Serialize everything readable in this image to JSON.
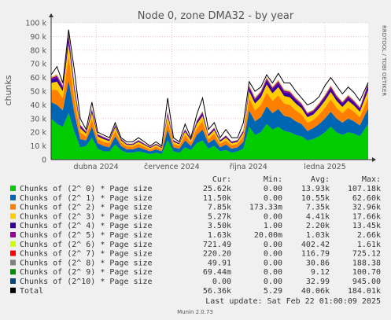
{
  "chart_data": {
    "type": "area",
    "title": "Node 0, zone DMA32 - by year",
    "ylabel": "chunks",
    "side_label": "RRDTOOL / TOBI OETIKER",
    "ylim": [
      0,
      100000
    ],
    "y_ticks": [
      {
        "value": 0,
        "label": "0"
      },
      {
        "value": 10000,
        "label": "10 k"
      },
      {
        "value": 20000,
        "label": "20 k"
      },
      {
        "value": 30000,
        "label": "30 k"
      },
      {
        "value": 40000,
        "label": "40 k"
      },
      {
        "value": 50000,
        "label": "50 k"
      },
      {
        "value": 60000,
        "label": "60 k"
      },
      {
        "value": 70000,
        "label": "70 k"
      },
      {
        "value": 80000,
        "label": "80 k"
      },
      {
        "value": 90000,
        "label": "90 k"
      },
      {
        "value": 100000,
        "label": "100 k"
      }
    ],
    "x_domain": [
      "2024-02-07",
      "2025-02-22"
    ],
    "x_ticks": [
      {
        "date": "2024-04-01",
        "label": "dubna 2024"
      },
      {
        "date": "2024-07-01",
        "label": "července 2024"
      },
      {
        "date": "2024-10-01",
        "label": "října 2024"
      },
      {
        "date": "2025-01-01",
        "label": "ledna 2025"
      }
    ],
    "sample_dates": [
      "2024-02-07",
      "2024-02-14",
      "2024-02-21",
      "2024-02-28",
      "2024-03-06",
      "2024-03-13",
      "2024-03-20",
      "2024-03-27",
      "2024-04-03",
      "2024-04-10",
      "2024-04-17",
      "2024-04-24",
      "2024-05-01",
      "2024-05-08",
      "2024-05-15",
      "2024-05-22",
      "2024-05-29",
      "2024-06-05",
      "2024-06-12",
      "2024-06-19",
      "2024-06-26",
      "2024-07-03",
      "2024-07-10",
      "2024-07-17",
      "2024-07-24",
      "2024-07-31",
      "2024-08-07",
      "2024-08-14",
      "2024-08-21",
      "2024-08-28",
      "2024-09-04",
      "2024-09-11",
      "2024-09-18",
      "2024-09-25",
      "2024-10-02",
      "2024-10-09",
      "2024-10-16",
      "2024-10-23",
      "2024-10-30",
      "2024-11-06",
      "2024-11-13",
      "2024-11-20",
      "2024-11-27",
      "2024-12-04",
      "2024-12-11",
      "2024-12-18",
      "2024-12-25",
      "2025-01-01",
      "2025-01-08",
      "2025-01-15",
      "2025-01-22",
      "2025-01-29",
      "2025-02-05",
      "2025-02-12",
      "2025-02-22"
    ],
    "columns": [
      "Cur:",
      "Min:",
      "Avg:",
      "Max:"
    ],
    "series": [
      {
        "name": "Chunks of (2^ 0) * Page size",
        "color": "#00cc00",
        "cur": "25.62k",
        "min": "0.00",
        "avg": "13.93k",
        "max": "107.18k",
        "values": [
          30000,
          26000,
          24000,
          34000,
          20000,
          9000,
          10000,
          16000,
          8000,
          6000,
          6000,
          11000,
          7000,
          5000,
          5000,
          6000,
          5000,
          4000,
          5000,
          4000,
          14000,
          6000,
          5000,
          9000,
          7000,
          12000,
          14000,
          8000,
          10000,
          6000,
          7000,
          5000,
          6000,
          8000,
          24000,
          18000,
          20000,
          26000,
          22000,
          24000,
          21000,
          20000,
          18000,
          17000,
          14000,
          15000,
          17000,
          20000,
          24000,
          20000,
          18000,
          20000,
          19000,
          17000,
          26000
        ]
      },
      {
        "name": "Chunks of (2^ 1) * Page size",
        "color": "#0066b3",
        "cur": "11.50k",
        "min": "0.00",
        "avg": "10.55k",
        "max": "62.60k",
        "values": [
          12000,
          14000,
          12000,
          24000,
          14000,
          6000,
          4000,
          8000,
          4000,
          4000,
          3000,
          6000,
          3000,
          2500,
          2500,
          3000,
          2500,
          2000,
          2500,
          2000,
          8000,
          3000,
          3000,
          5000,
          3000,
          6000,
          8000,
          4000,
          5000,
          3000,
          4000,
          3000,
          3000,
          5000,
          12000,
          10000,
          11000,
          13000,
          12000,
          13000,
          11000,
          11000,
          10000,
          9000,
          7000,
          8000,
          9000,
          10000,
          11000,
          10000,
          9000,
          10000,
          9000,
          8000,
          11500
        ]
      },
      {
        "name": "Chunks of (2^ 2) * Page size",
        "color": "#ff8000",
        "cur": "7.85k",
        "min": "173.33m",
        "avg": "7.35k",
        "max": "32.96k",
        "values": [
          9000,
          11000,
          9000,
          18000,
          10000,
          5000,
          3000,
          6000,
          3000,
          3000,
          3000,
          4000,
          2500,
          2000,
          2000,
          2500,
          2000,
          1500,
          2000,
          1500,
          6000,
          2500,
          2000,
          4000,
          2500,
          5000,
          6000,
          3000,
          4000,
          2500,
          3000,
          2500,
          2500,
          4000,
          9000,
          8000,
          9000,
          10000,
          9000,
          10000,
          9000,
          9000,
          8000,
          7000,
          6000,
          6000,
          7000,
          8000,
          9000,
          8000,
          7000,
          8000,
          7000,
          6000,
          7850
        ]
      },
      {
        "name": "Chunks of (2^ 3) * Page size",
        "color": "#ffcc00",
        "cur": "5.27k",
        "min": "0.00",
        "avg": "4.41k",
        "max": "17.66k",
        "values": [
          5000,
          6000,
          5000,
          9000,
          6000,
          3000,
          2000,
          4000,
          2000,
          2000,
          1500,
          2500,
          1500,
          1200,
          1200,
          1500,
          1200,
          1000,
          1200,
          1000,
          4000,
          1500,
          1200,
          2500,
          1500,
          3000,
          4000,
          2000,
          2500,
          1500,
          2000,
          1500,
          1500,
          2500,
          5000,
          5000,
          5500,
          6000,
          5500,
          6000,
          5500,
          5500,
          5000,
          4500,
          4000,
          4000,
          4500,
          5000,
          5500,
          5000,
          4500,
          5000,
          4500,
          4000,
          5270
        ]
      },
      {
        "name": "Chunks of (2^ 4) * Page size",
        "color": "#330099",
        "cur": "3.50k",
        "min": "1.00",
        "avg": "2.20k",
        "max": "13.45k",
        "values": [
          2500,
          3000,
          2500,
          5000,
          3000,
          1500,
          1000,
          2000,
          1000,
          1000,
          800,
          1200,
          800,
          600,
          600,
          800,
          600,
          500,
          600,
          500,
          2000,
          800,
          600,
          1200,
          800,
          1500,
          2000,
          1000,
          1200,
          800,
          1000,
          800,
          800,
          1200,
          2500,
          2500,
          2800,
          3000,
          2800,
          3000,
          2800,
          2800,
          2500,
          2200,
          2000,
          2000,
          2200,
          2500,
          2800,
          2500,
          2200,
          2500,
          2200,
          2000,
          3500
        ]
      },
      {
        "name": "Chunks of (2^ 5) * Page size",
        "color": "#990099",
        "cur": "1.63k",
        "min": "20.00m",
        "avg": "1.03k",
        "max": "2.66k",
        "values": [
          1200,
          1400,
          1200,
          2000,
          1400,
          800,
          500,
          1000,
          500,
          500,
          400,
          600,
          400,
          300,
          300,
          400,
          300,
          250,
          300,
          250,
          1000,
          400,
          300,
          600,
          400,
          800,
          1000,
          500,
          600,
          400,
          500,
          400,
          400,
          600,
          1200,
          1200,
          1300,
          1400,
          1300,
          1400,
          1300,
          1300,
          1200,
          1100,
          1000,
          1000,
          1100,
          1200,
          1300,
          1200,
          1100,
          1200,
          1100,
          1000,
          1630
        ]
      },
      {
        "name": "Chunks of (2^ 6) * Page size",
        "color": "#ccff00",
        "cur": "721.49",
        "min": "0.00",
        "avg": "402.42",
        "max": "1.61k",
        "values": [
          500,
          600,
          500,
          900,
          600,
          300,
          200,
          400,
          200,
          200,
          150,
          250,
          150,
          120,
          120,
          150,
          120,
          100,
          120,
          100,
          400,
          150,
          120,
          250,
          150,
          300,
          400,
          200,
          250,
          150,
          200,
          150,
          150,
          250,
          500,
          500,
          550,
          600,
          550,
          600,
          550,
          550,
          500,
          450,
          400,
          400,
          450,
          500,
          550,
          500,
          450,
          500,
          450,
          400,
          721
        ]
      },
      {
        "name": "Chunks of (2^ 7) * Page size",
        "color": "#ff0000",
        "cur": "220.20",
        "min": "0.00",
        "avg": "116.79",
        "max": "725.12",
        "values": [
          150,
          180,
          150,
          300,
          180,
          90,
          60,
          120,
          60,
          60,
          45,
          75,
          45,
          36,
          36,
          45,
          36,
          30,
          36,
          30,
          120,
          45,
          36,
          75,
          45,
          90,
          120,
          60,
          75,
          45,
          60,
          45,
          45,
          75,
          150,
          150,
          165,
          180,
          165,
          180,
          165,
          165,
          150,
          135,
          120,
          120,
          135,
          150,
          165,
          150,
          135,
          150,
          135,
          120,
          220
        ]
      },
      {
        "name": "Chunks of (2^ 8) * Page size",
        "color": "#808080",
        "cur": "49.91",
        "min": "0.00",
        "avg": "30.86",
        "max": "188.38",
        "values": [
          40,
          45,
          40,
          80,
          45,
          24,
          16,
          30,
          16,
          16,
          12,
          20,
          12,
          10,
          10,
          12,
          10,
          8,
          10,
          8,
          30,
          12,
          10,
          20,
          12,
          24,
          30,
          16,
          20,
          12,
          16,
          12,
          12,
          20,
          40,
          40,
          44,
          48,
          44,
          48,
          44,
          44,
          40,
          36,
          32,
          32,
          36,
          40,
          44,
          40,
          36,
          40,
          36,
          32,
          50
        ]
      },
      {
        "name": "Chunks of (2^ 9) * Page size",
        "color": "#008f00",
        "cur": "69.44m",
        "min": "0.00",
        "avg": "9.12",
        "max": "100.70",
        "values": [
          12,
          14,
          12,
          25,
          14,
          7,
          5,
          9,
          5,
          5,
          4,
          6,
          4,
          3,
          3,
          4,
          3,
          2,
          3,
          2,
          9,
          4,
          3,
          6,
          4,
          7,
          9,
          5,
          6,
          4,
          5,
          4,
          4,
          6,
          12,
          12,
          13,
          14,
          13,
          14,
          13,
          13,
          12,
          11,
          10,
          10,
          11,
          12,
          13,
          12,
          11,
          12,
          11,
          10,
          0.07
        ]
      },
      {
        "name": "Chunks of (2^10) * Page size",
        "color": "#00487d",
        "cur": "0.00",
        "min": "0.00",
        "avg": "32.99",
        "max": "945.00",
        "values": [
          40,
          30,
          20,
          60,
          30,
          10,
          0,
          0,
          0,
          0,
          0,
          0,
          0,
          0,
          0,
          0,
          0,
          0,
          0,
          0,
          0,
          0,
          0,
          0,
          0,
          0,
          0,
          0,
          0,
          0,
          0,
          0,
          0,
          0,
          0,
          0,
          0,
          0,
          0,
          0,
          0,
          0,
          0,
          0,
          0,
          0,
          0,
          0,
          0,
          0,
          0,
          0,
          0,
          0,
          0
        ]
      }
    ],
    "total": {
      "name": "Total",
      "color": "#000000",
      "cur": "56.36k",
      "min": "5.29",
      "avg": "40.06k",
      "max": "184.01k",
      "values": [
        62000,
        68000,
        56000,
        95000,
        65000,
        30000,
        22000,
        42000,
        20000,
        18000,
        16000,
        27000,
        16000,
        13000,
        13000,
        16000,
        13000,
        10000,
        13000,
        10000,
        45000,
        16000,
        13000,
        26000,
        16000,
        33000,
        45000,
        22000,
        27000,
        16000,
        22000,
        16000,
        16000,
        27000,
        57000,
        50000,
        53000,
        62000,
        56000,
        63000,
        56000,
        56000,
        50000,
        45000,
        40000,
        42000,
        46000,
        54000,
        60000,
        54000,
        48000,
        53000,
        49000,
        43000,
        56360
      ]
    },
    "grid": true,
    "legend_placement": "bottom"
  },
  "footer": {
    "last_update": "Last update: Sat Feb 22 01:00:09 2025",
    "munin_version": "Munin 2.0.73"
  }
}
